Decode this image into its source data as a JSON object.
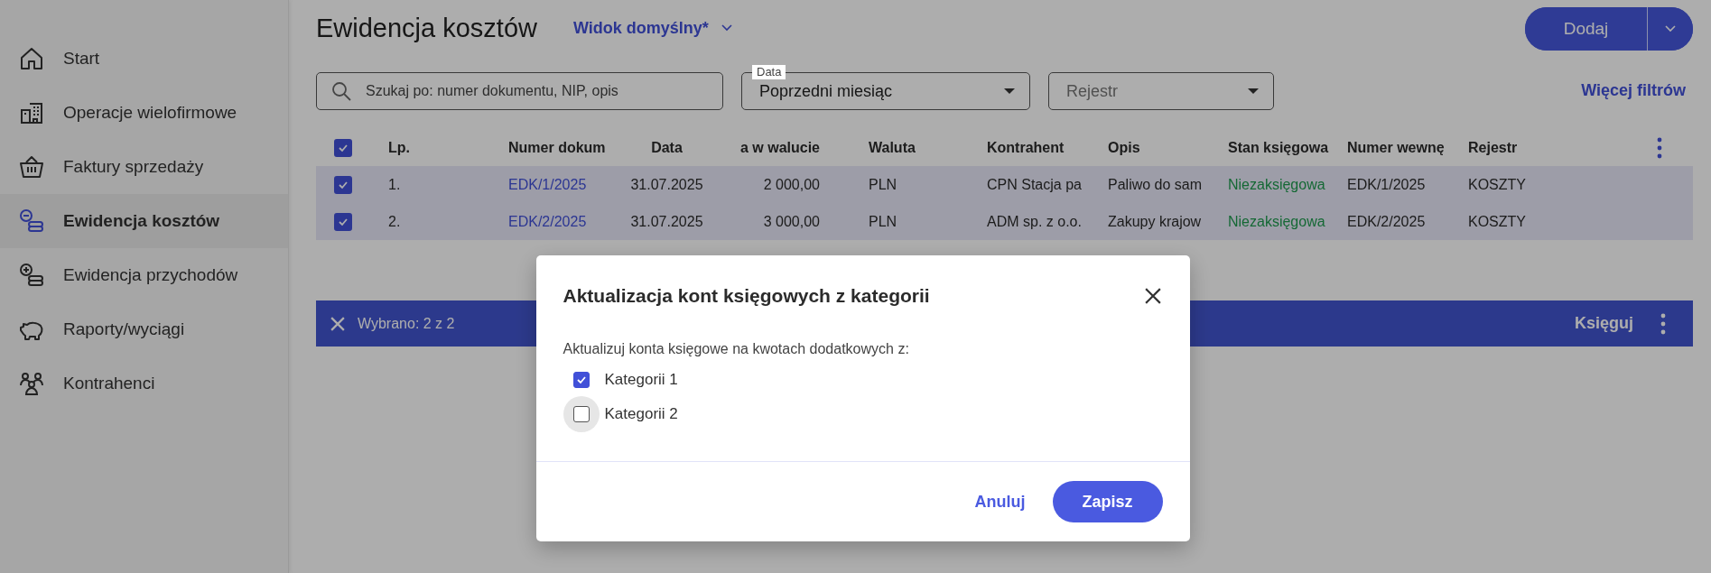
{
  "sidebar": {
    "items": [
      {
        "label": "Start",
        "selected": false
      },
      {
        "label": "Operacje wielofirmowe",
        "selected": false
      },
      {
        "label": "Faktury sprzedaży",
        "selected": false
      },
      {
        "label": "Ewidencja kosztów",
        "selected": true
      },
      {
        "label": "Ewidencja przychodów",
        "selected": false
      },
      {
        "label": "Raporty/wyciągi",
        "selected": false
      },
      {
        "label": "Kontrahenci",
        "selected": false
      }
    ]
  },
  "header": {
    "title": "Ewidencja kosztów",
    "view": "Widok domyślny*",
    "add_button": "Dodaj"
  },
  "filters": {
    "search": {
      "placeholder": "Szukaj po: numer dokumentu, NIP, opis"
    },
    "date": {
      "label": "Data",
      "value": "Poprzedni miesiąc"
    },
    "register": {
      "placeholder": "Rejestr"
    },
    "more": "Więcej filtrów"
  },
  "table": {
    "all_checked": true,
    "columns": [
      {
        "label": "Lp.",
        "kind": "text"
      },
      {
        "label": "Numer dokum",
        "kind": "link"
      },
      {
        "label": "Data",
        "kind": "center"
      },
      {
        "label": "a w walucie",
        "kind": "amount"
      },
      {
        "label": "Waluta",
        "kind": "text"
      },
      {
        "label": "Kontrahent",
        "kind": "text"
      },
      {
        "label": "Opis",
        "kind": "text"
      },
      {
        "label": "Stan księgowa",
        "kind": "status"
      },
      {
        "label": "Numer wewnę",
        "kind": "text"
      },
      {
        "label": "Rejestr",
        "kind": "text"
      }
    ],
    "rows": [
      {
        "checked": true,
        "cells": [
          "1.",
          "EDK/1/2025",
          "31.07.2025",
          "2 000,00",
          "PLN",
          "CPN Stacja pa",
          "Paliwo do sam",
          "Niezaksięgowa",
          "EDK/1/2025",
          "KOSZTY"
        ]
      },
      {
        "checked": true,
        "cells": [
          "2.",
          "EDK/2/2025",
          "31.07.2025",
          "3 000,00",
          "PLN",
          "ADM sp. z o.o.",
          "Zakupy krajow",
          "Niezaksięgowa",
          "EDK/2/2025",
          "KOSZTY"
        ]
      }
    ]
  },
  "selection_bar": {
    "text": "Wybrano: 2 z 2",
    "action": "Księguj"
  },
  "dialog": {
    "title": "Aktualizacja kont księgowych z kategorii",
    "prompt": "Aktualizuj konta księgowe na kwotach dodatkowych z:",
    "options": [
      {
        "label": "Kategorii 1",
        "checked": true,
        "focused": false
      },
      {
        "label": "Kategorii 2",
        "checked": false,
        "focused": true
      }
    ],
    "cancel": "Anuluj",
    "save": "Zapisz"
  }
}
